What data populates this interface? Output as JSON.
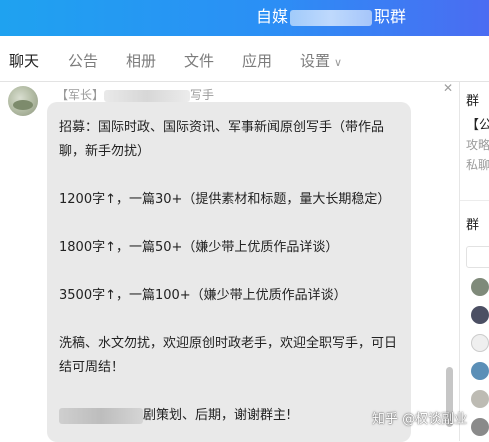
{
  "window": {
    "title_start": "自媒",
    "title_end": "职群"
  },
  "tabs": [
    {
      "label": "聊天",
      "active": true
    },
    {
      "label": "公告"
    },
    {
      "label": "相册"
    },
    {
      "label": "文件"
    },
    {
      "label": "应用"
    },
    {
      "label": "设置"
    }
  ],
  "message": {
    "sender_role": "【军长】",
    "sender_tail": "写手",
    "paragraphs": [
      "招募：国际时政、国际资讯、军事新闻原创写手（带作品聊，新手勿扰）",
      "1200字↑，一篇30+（提供素材和标题，量大长期稳定）",
      "1800字↑，一篇50+（嫌少带上优质作品详谈）",
      "3500字↑，一篇100+（嫌少带上优质作品详谈）",
      "洗稿、水文勿扰，欢迎原创时政老手，欢迎全职写手，可日结可周结！"
    ],
    "last_line_tail": "剧策划、后期，谢谢群主!"
  },
  "side_panel": {
    "heading_1": "群",
    "line_1": "【公",
    "line_2": "攻略",
    "line_3": "私聊",
    "heading_2": "群",
    "members": [
      {
        "color": "#7f8a7a"
      },
      {
        "color": "#4b4f63"
      },
      {
        "color": "#efefef"
      },
      {
        "color": "#5b8fb7"
      },
      {
        "color": "#bdbbb3"
      },
      {
        "color": "#8a8a8a"
      }
    ]
  },
  "watermark": "知乎 @权谈副业",
  "colors": {
    "accent": "#2b8ff5",
    "phone_icon": "#17c26a",
    "bubble": "#e9e9e9"
  }
}
